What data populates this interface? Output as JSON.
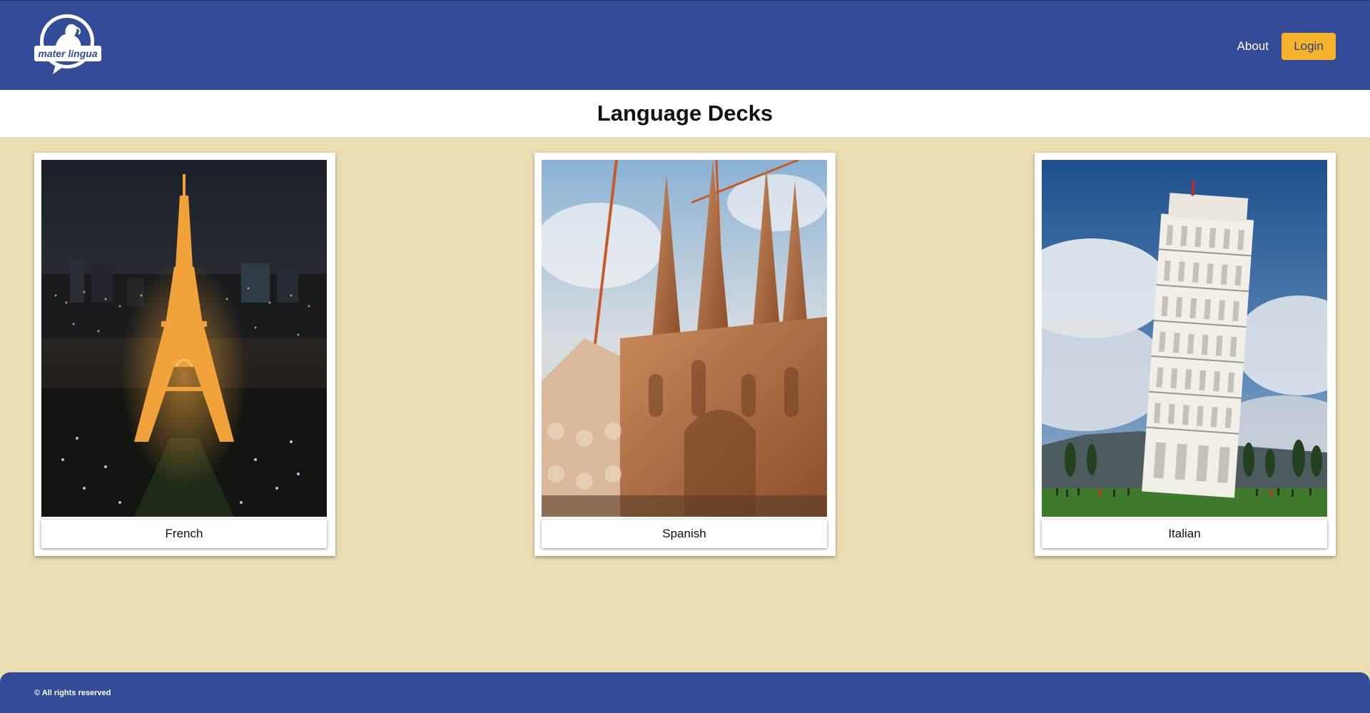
{
  "header": {
    "logo_text": "mater lingua",
    "nav": {
      "about_label": "About",
      "login_label": "Login"
    }
  },
  "main": {
    "title": "Language Decks",
    "decks": [
      {
        "label": "French",
        "image": "eiffel-tower-night"
      },
      {
        "label": "Spanish",
        "image": "sagrada-familia"
      },
      {
        "label": "Italian",
        "image": "leaning-tower-of-pisa"
      }
    ]
  },
  "footer": {
    "copyright": "© All rights reserved"
  },
  "colors": {
    "header_bg": "#344b97",
    "page_bg": "#ecdeb3",
    "login_button": "#f6b42c"
  }
}
